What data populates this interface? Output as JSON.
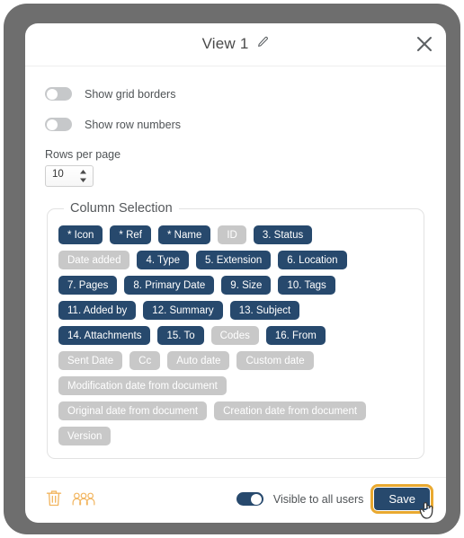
{
  "dialog": {
    "title": "View 1",
    "edit_icon": "pencil-icon",
    "close_icon": "close-icon"
  },
  "settings": {
    "toggles": [
      {
        "label": "Show grid borders",
        "on": false
      },
      {
        "label": "Show row numbers",
        "on": false
      }
    ],
    "rows_per_page": {
      "label": "Rows per page",
      "value": "10"
    }
  },
  "column_selection": {
    "legend": "Column Selection",
    "rows": [
      [
        {
          "label": "* Icon",
          "selected": true
        },
        {
          "label": "* Ref",
          "selected": true
        },
        {
          "label": "* Name",
          "selected": true
        },
        {
          "label": "ID",
          "selected": false
        },
        {
          "label": "3. Status",
          "selected": true
        }
      ],
      [
        {
          "label": "Date added",
          "selected": false
        },
        {
          "label": "4. Type",
          "selected": true
        },
        {
          "label": "5. Extension",
          "selected": true
        },
        {
          "label": "6. Location",
          "selected": true
        }
      ],
      [
        {
          "label": "7. Pages",
          "selected": true
        },
        {
          "label": "8. Primary Date",
          "selected": true
        },
        {
          "label": "9. Size",
          "selected": true
        },
        {
          "label": "10. Tags",
          "selected": true
        }
      ],
      [
        {
          "label": "11. Added by",
          "selected": true
        },
        {
          "label": "12. Summary",
          "selected": true
        },
        {
          "label": "13. Subject",
          "selected": true
        }
      ],
      [
        {
          "label": "14. Attachments",
          "selected": true
        },
        {
          "label": "15. To",
          "selected": true
        },
        {
          "label": "Codes",
          "selected": false
        },
        {
          "label": "16. From",
          "selected": true
        }
      ],
      [
        {
          "label": "Sent Date",
          "selected": false
        },
        {
          "label": "Cc",
          "selected": false
        },
        {
          "label": "Auto date",
          "selected": false
        },
        {
          "label": "Custom date",
          "selected": false
        }
      ],
      [
        {
          "label": "Modification date from document",
          "selected": false
        }
      ],
      [
        {
          "label": "Original date from document",
          "selected": false
        },
        {
          "label": "Creation date from document",
          "selected": false
        }
      ],
      [
        {
          "label": "Version",
          "selected": false
        }
      ]
    ]
  },
  "footer": {
    "delete_icon": "trash-icon",
    "share_icon": "people-group-icon",
    "visible_toggle": {
      "label": "Visible to all users",
      "on": true
    },
    "save_label": "Save",
    "cursor_icon": "hand-cursor-icon"
  },
  "colors": {
    "chip_selected": "#27496d",
    "chip_unselected": "#c8c8c8",
    "accent_gold": "#e9a930",
    "icon_gold": "#f2b661",
    "frame": "#6e6e6e"
  }
}
